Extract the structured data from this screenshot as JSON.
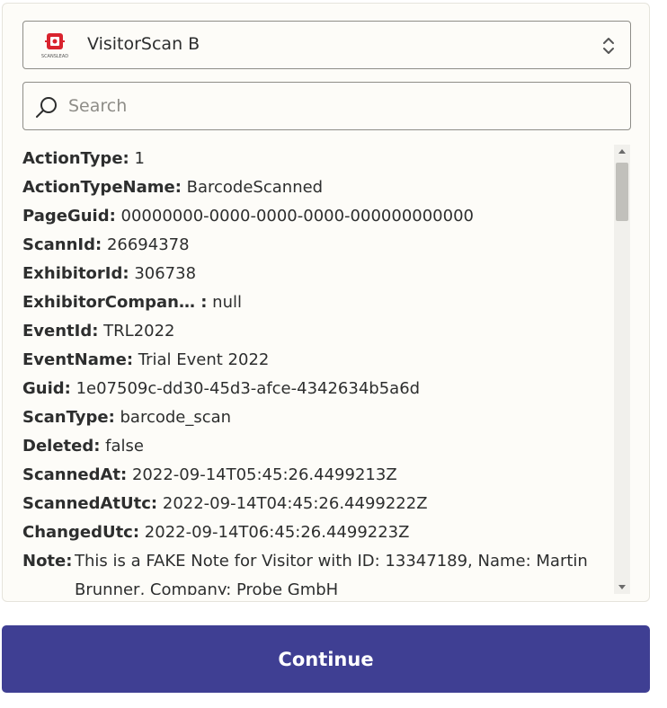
{
  "app_select": {
    "name": "VisitorScan B",
    "logo_caption": "SCANSLEAD",
    "logo_color": "#d9232e"
  },
  "search": {
    "placeholder": "Search",
    "value": ""
  },
  "fields": [
    {
      "key": "ActionType:",
      "value": "1"
    },
    {
      "key": "ActionTypeName:",
      "value": "BarcodeScanned"
    },
    {
      "key": "PageGuid:",
      "value": "00000000-0000-0000-0000-000000000000"
    },
    {
      "key": "ScannId:",
      "value": "26694378"
    },
    {
      "key": "ExhibitorId:",
      "value": "306738"
    },
    {
      "key": "ExhibitorCompan… :",
      "value": "null"
    },
    {
      "key": "EventId:",
      "value": "TRL2022"
    },
    {
      "key": "EventName:",
      "value": "Trial Event 2022"
    },
    {
      "key": "Guid:",
      "value": "1e07509c-dd30-45d3-afce-4342634b5a6d"
    },
    {
      "key": "ScanType:",
      "value": "barcode_scan"
    },
    {
      "key": "Deleted:",
      "value": "false"
    },
    {
      "key": "ScannedAt:",
      "value": "2022-09-14T05:45:26.4499213Z"
    },
    {
      "key": "ScannedAtUtc:",
      "value": "2022-09-14T04:45:26.4499222Z"
    },
    {
      "key": "ChangedUtc:",
      "value": "2022-09-14T06:45:26.4499223Z"
    },
    {
      "key": "Note:",
      "value": "This is a FAKE Note for Visitor with ID: 13347189, Name: Martin Brunner, Company: Probe GmbH"
    }
  ],
  "actions": {
    "continue_label": "Continue"
  },
  "colors": {
    "accent": "#3f3f93",
    "panel_bg": "#fdfcf8",
    "border": "#8e8d88"
  }
}
